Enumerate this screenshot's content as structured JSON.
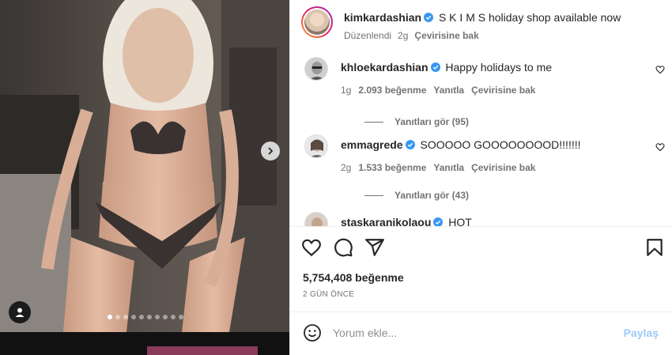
{
  "post": {
    "author": "kimkardashian",
    "caption": "S K I M S holiday shop available now",
    "edited_label": "Düzenlendi",
    "time_ago": "2g",
    "translate_label": "Çevirisine bak",
    "likes_text": "5,754,408 beğenme",
    "date_text": "2 GÜN ÖNCE",
    "carousel": {
      "total": 10,
      "active_index": 0
    }
  },
  "comments": [
    {
      "username": "khloekardashian",
      "text": "Happy holidays to me",
      "time": "1g",
      "likes": "2.093 beğenme",
      "reply_label": "Yanıtla",
      "translate_label": "Çevirisine bak",
      "view_replies": "Yanıtları gör (95)"
    },
    {
      "username": "emmagrede",
      "text": "SOOOOO GOOOOOOOOD!!!!!!!",
      "time": "2g",
      "likes": "1.533 beğenme",
      "reply_label": "Yanıtla",
      "translate_label": "Çevirisine bak",
      "view_replies": "Yanıtları gör (43)"
    },
    {
      "username": "staskaranikolaou",
      "text": "HOT"
    }
  ],
  "comment_input": {
    "placeholder": "Yorum ekle...",
    "share_label": "Paylaş"
  },
  "colors": {
    "verified": "#3897f0",
    "share_disabled": "#9fcaf7",
    "muted": "#737373"
  },
  "icons": [
    "heart-icon",
    "comment-icon",
    "share-icon",
    "save-icon",
    "emoji-icon",
    "user-tag-icon",
    "chevron-right-icon",
    "verified-badge-icon"
  ]
}
